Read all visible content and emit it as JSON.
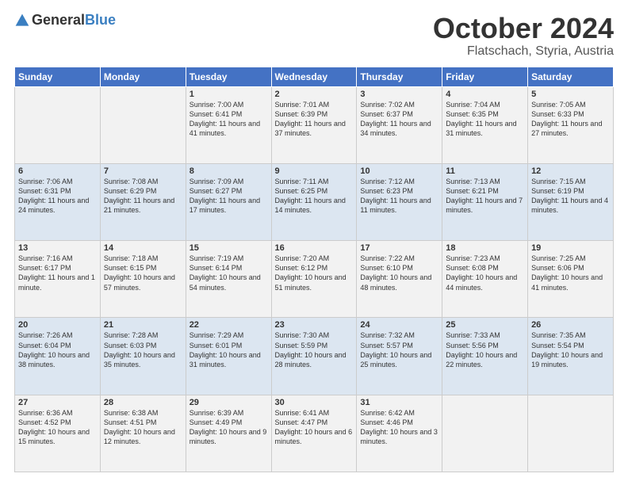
{
  "header": {
    "logo_line1": "General",
    "logo_line2": "Blue",
    "month": "October 2024",
    "location": "Flatschach, Styria, Austria"
  },
  "weekdays": [
    "Sunday",
    "Monday",
    "Tuesday",
    "Wednesday",
    "Thursday",
    "Friday",
    "Saturday"
  ],
  "weeks": [
    [
      null,
      null,
      {
        "day": 1,
        "sunrise": "7:00 AM",
        "sunset": "6:41 PM",
        "daylight": "11 hours and 41 minutes."
      },
      {
        "day": 2,
        "sunrise": "7:01 AM",
        "sunset": "6:39 PM",
        "daylight": "11 hours and 37 minutes."
      },
      {
        "day": 3,
        "sunrise": "7:02 AM",
        "sunset": "6:37 PM",
        "daylight": "11 hours and 34 minutes."
      },
      {
        "day": 4,
        "sunrise": "7:04 AM",
        "sunset": "6:35 PM",
        "daylight": "11 hours and 31 minutes."
      },
      {
        "day": 5,
        "sunrise": "7:05 AM",
        "sunset": "6:33 PM",
        "daylight": "11 hours and 27 minutes."
      }
    ],
    [
      {
        "day": 6,
        "sunrise": "7:06 AM",
        "sunset": "6:31 PM",
        "daylight": "11 hours and 24 minutes."
      },
      {
        "day": 7,
        "sunrise": "7:08 AM",
        "sunset": "6:29 PM",
        "daylight": "11 hours and 21 minutes."
      },
      {
        "day": 8,
        "sunrise": "7:09 AM",
        "sunset": "6:27 PM",
        "daylight": "11 hours and 17 minutes."
      },
      {
        "day": 9,
        "sunrise": "7:11 AM",
        "sunset": "6:25 PM",
        "daylight": "11 hours and 14 minutes."
      },
      {
        "day": 10,
        "sunrise": "7:12 AM",
        "sunset": "6:23 PM",
        "daylight": "11 hours and 11 minutes."
      },
      {
        "day": 11,
        "sunrise": "7:13 AM",
        "sunset": "6:21 PM",
        "daylight": "11 hours and 7 minutes."
      },
      {
        "day": 12,
        "sunrise": "7:15 AM",
        "sunset": "6:19 PM",
        "daylight": "11 hours and 4 minutes."
      }
    ],
    [
      {
        "day": 13,
        "sunrise": "7:16 AM",
        "sunset": "6:17 PM",
        "daylight": "11 hours and 1 minute."
      },
      {
        "day": 14,
        "sunrise": "7:18 AM",
        "sunset": "6:15 PM",
        "daylight": "10 hours and 57 minutes."
      },
      {
        "day": 15,
        "sunrise": "7:19 AM",
        "sunset": "6:14 PM",
        "daylight": "10 hours and 54 minutes."
      },
      {
        "day": 16,
        "sunrise": "7:20 AM",
        "sunset": "6:12 PM",
        "daylight": "10 hours and 51 minutes."
      },
      {
        "day": 17,
        "sunrise": "7:22 AM",
        "sunset": "6:10 PM",
        "daylight": "10 hours and 48 minutes."
      },
      {
        "day": 18,
        "sunrise": "7:23 AM",
        "sunset": "6:08 PM",
        "daylight": "10 hours and 44 minutes."
      },
      {
        "day": 19,
        "sunrise": "7:25 AM",
        "sunset": "6:06 PM",
        "daylight": "10 hours and 41 minutes."
      }
    ],
    [
      {
        "day": 20,
        "sunrise": "7:26 AM",
        "sunset": "6:04 PM",
        "daylight": "10 hours and 38 minutes."
      },
      {
        "day": 21,
        "sunrise": "7:28 AM",
        "sunset": "6:03 PM",
        "daylight": "10 hours and 35 minutes."
      },
      {
        "day": 22,
        "sunrise": "7:29 AM",
        "sunset": "6:01 PM",
        "daylight": "10 hours and 31 minutes."
      },
      {
        "day": 23,
        "sunrise": "7:30 AM",
        "sunset": "5:59 PM",
        "daylight": "10 hours and 28 minutes."
      },
      {
        "day": 24,
        "sunrise": "7:32 AM",
        "sunset": "5:57 PM",
        "daylight": "10 hours and 25 minutes."
      },
      {
        "day": 25,
        "sunrise": "7:33 AM",
        "sunset": "5:56 PM",
        "daylight": "10 hours and 22 minutes."
      },
      {
        "day": 26,
        "sunrise": "7:35 AM",
        "sunset": "5:54 PM",
        "daylight": "10 hours and 19 minutes."
      }
    ],
    [
      {
        "day": 27,
        "sunrise": "6:36 AM",
        "sunset": "4:52 PM",
        "daylight": "10 hours and 15 minutes."
      },
      {
        "day": 28,
        "sunrise": "6:38 AM",
        "sunset": "4:51 PM",
        "daylight": "10 hours and 12 minutes."
      },
      {
        "day": 29,
        "sunrise": "6:39 AM",
        "sunset": "4:49 PM",
        "daylight": "10 hours and 9 minutes."
      },
      {
        "day": 30,
        "sunrise": "6:41 AM",
        "sunset": "4:47 PM",
        "daylight": "10 hours and 6 minutes."
      },
      {
        "day": 31,
        "sunrise": "6:42 AM",
        "sunset": "4:46 PM",
        "daylight": "10 hours and 3 minutes."
      },
      null,
      null
    ]
  ]
}
